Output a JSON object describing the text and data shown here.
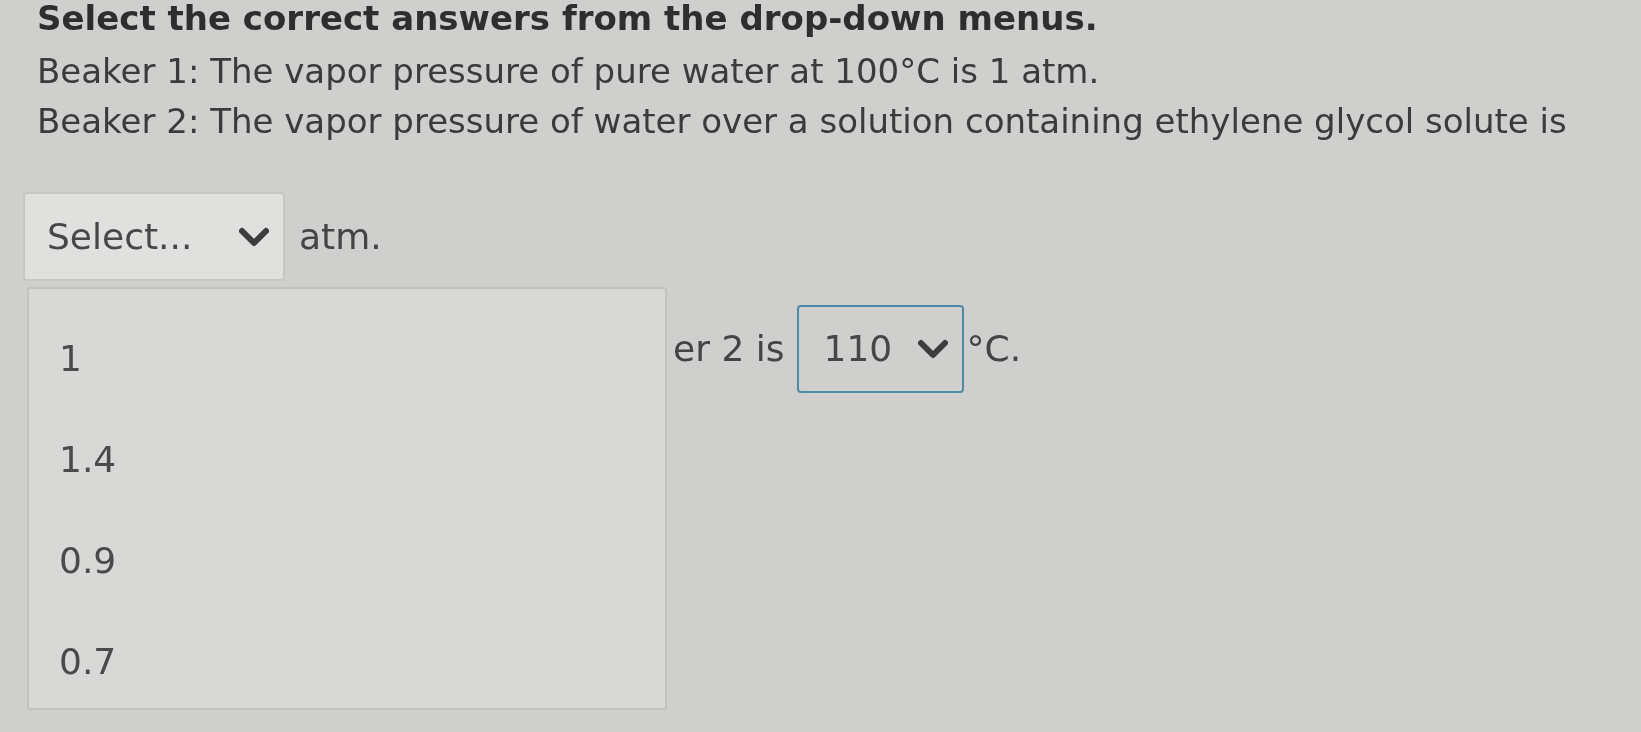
{
  "instruction": "Select the correct answers from the drop-down menus.",
  "statements": [
    "Beaker 1: The vapor pressure of pure water at 100°C is 1 atm.",
    "Beaker 2: The vapor pressure of water over a solution containing ethylene glycol solute is"
  ],
  "blanks": [
    {
      "dropdown": {
        "placeholder": "Select...",
        "expanded": true,
        "focused": false,
        "options": [
          {
            "label": "1",
            "selected": false
          },
          {
            "label": "1.4",
            "selected": false
          },
          {
            "label": "0.9",
            "selected": false
          },
          {
            "label": "0.7",
            "selected": false
          }
        ]
      },
      "suffix": "atm."
    },
    {
      "prefix": "er 2 is",
      "dropdown": {
        "value": "110",
        "expanded": false,
        "focused": true
      },
      "suffix": "°C."
    }
  ]
}
